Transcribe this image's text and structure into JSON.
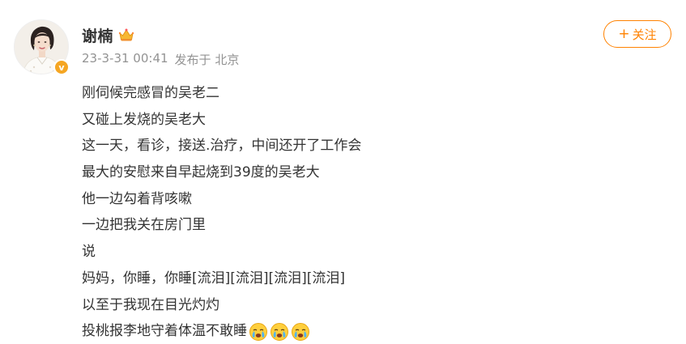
{
  "post": {
    "author_name": "谢楠",
    "author_badge_icon": "crown-icon",
    "timestamp": "23-3-31 00:41",
    "location": "发布于 北京",
    "verified_mark": "v",
    "follow_label": "关注",
    "follow_icon": "plus-icon"
  },
  "content": {
    "lines": [
      "刚伺候完感冒的吴老二",
      "又碰上发烧的吴老大",
      "这一天，看诊，接送.治疗，中间还开了工作会",
      "最大的安慰来自早起烧到39度的吴老大",
      "他一边勾着背咳嗽",
      "一边把我关在房门里",
      "说",
      "妈妈，你睡，你睡[流泪][流泪][流泪][流泪]",
      "以至于我现在目光灼灼",
      "投桃报李地守着体温不敢睡"
    ],
    "trailing_emoji_icon": "crying-face-icon"
  },
  "colors": {
    "accent": "#ff8200",
    "text": "#333333",
    "meta": "#939393",
    "badge": "#f5a623"
  }
}
